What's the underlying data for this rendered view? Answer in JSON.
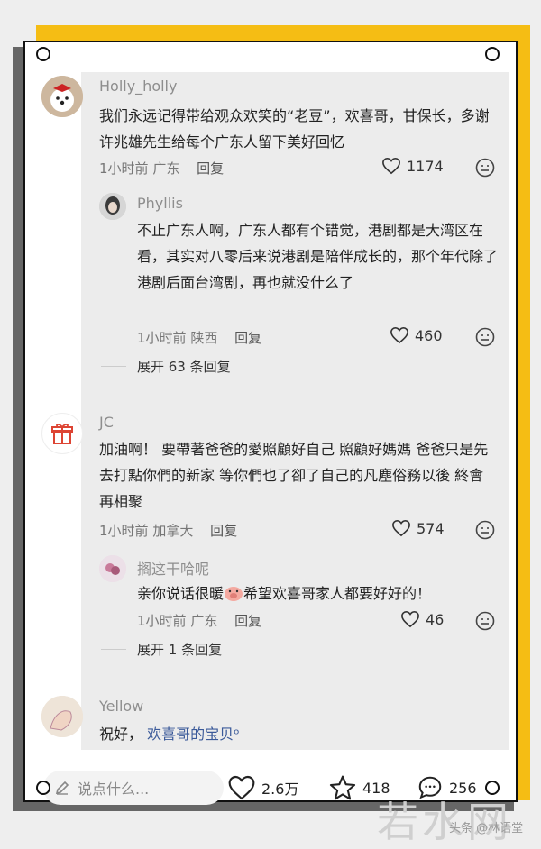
{
  "comments": [
    {
      "user": "Holly_holly",
      "text": "我们永远记得带给观众欢笑的“老豆”，欢喜哥，甘保长，多谢许兆雄先生给每个广东人留下美好回忆",
      "time": "1小时前",
      "region": "广东",
      "reply_label": "回复",
      "likes": "1174"
    },
    {
      "user": "Phyllis",
      "text": "不止广东人啊，广东人都有个错觉，港剧都是大湾区在看，其实对八零后来说港剧是陪伴成长的，那个年代除了港剧后面台湾剧，再也就没什么了",
      "time": "1小时前",
      "region": "陕西",
      "reply_label": "回复",
      "likes": "460",
      "expand": "展开 63 条回复"
    },
    {
      "user": "JC",
      "text": "加油啊！ 要帶著爸爸的愛照顧好自己 照顧好媽媽 爸爸只是先去打點你們的新家 等你們也了卻了自己的凡塵俗務以後 終會再相聚",
      "time": "1小时前",
      "region": "加拿大",
      "reply_label": "回复",
      "likes": "574"
    },
    {
      "user": "搁这干哈呢",
      "text_a": "亲你说话很暖",
      "text_b": "希望欢喜哥家人都要好好的！",
      "time": "1小时前",
      "region": "广东",
      "reply_label": "回复",
      "likes": "46",
      "expand": "展开 1 条回复"
    },
    {
      "user": "Yellow",
      "text_a": "祝好，",
      "text_link": "欢喜哥的宝贝",
      "text_end": "ᵒ"
    }
  ],
  "bottom": {
    "placeholder": "说点什么...",
    "likes": "2.6万",
    "stars": "418",
    "comments": "256"
  },
  "watermark": {
    "big": "若水网",
    "small": "头条 @林语堂"
  },
  "colors": {
    "frame": "#f5bd14",
    "link": "#3b5a9a"
  }
}
